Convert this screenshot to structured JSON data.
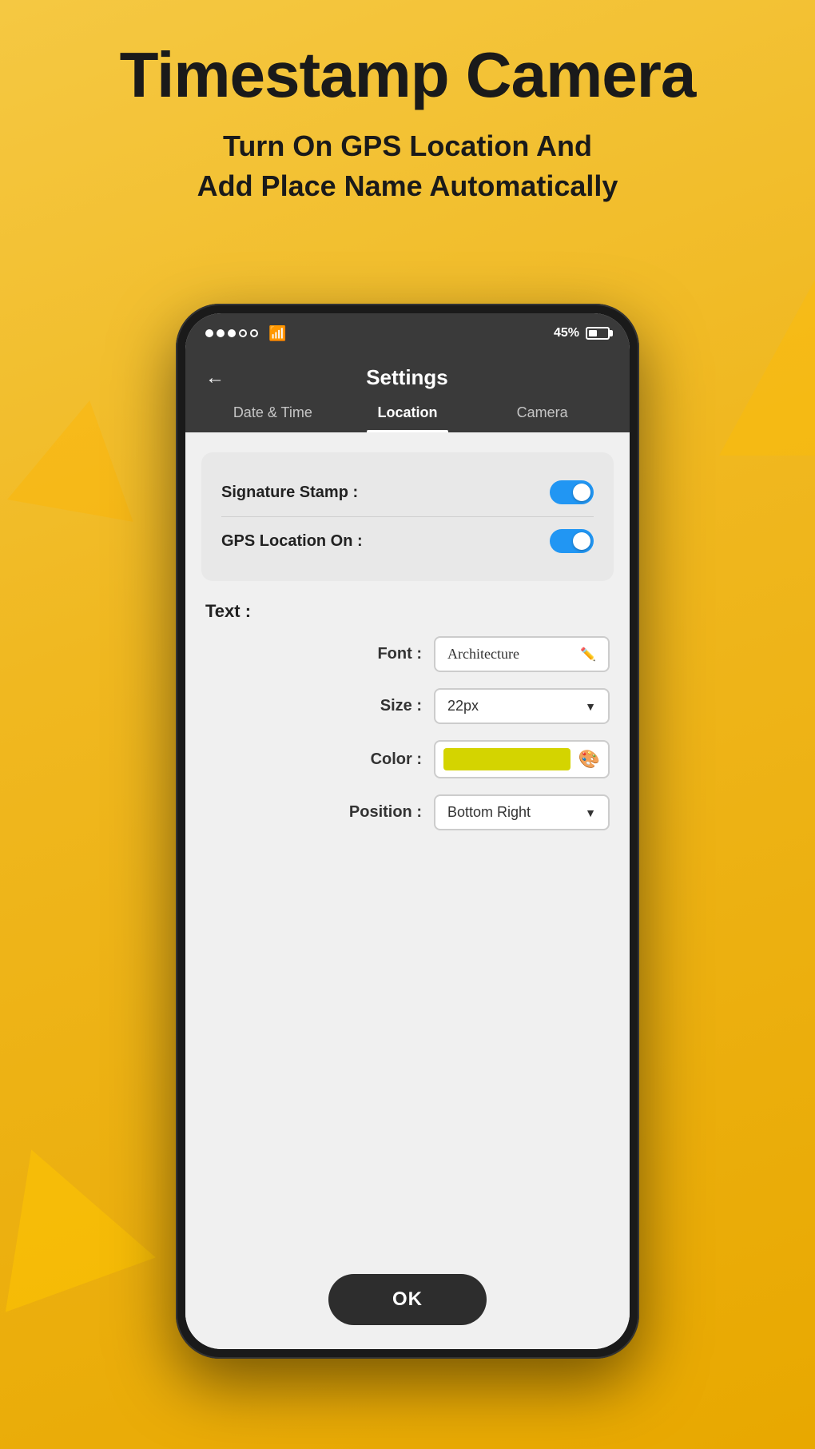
{
  "header": {
    "title": "Timestamp Camera",
    "subtitle_line1": "Turn On GPS Location And",
    "subtitle_line2": "Add Place Name Automatically"
  },
  "status_bar": {
    "battery_percent": "45%",
    "wifi_label": "wifi"
  },
  "app_header": {
    "page_title": "Settings",
    "back_label": "←"
  },
  "tabs": [
    {
      "label": "Date & Time",
      "active": false
    },
    {
      "label": "Location",
      "active": true
    },
    {
      "label": "Camera",
      "active": false
    }
  ],
  "toggles": {
    "signature_stamp_label": "Signature Stamp :",
    "gps_location_label": "GPS Location On :",
    "signature_stamp_on": true,
    "gps_location_on": true
  },
  "text_section": {
    "title": "Text :",
    "font_label": "Font :",
    "font_value": "Architecture",
    "size_label": "Size :",
    "size_value": "22px",
    "color_label": "Color :",
    "color_hex": "#d4d400",
    "position_label": "Position :",
    "position_value": "Bottom Right"
  },
  "ok_button": "OK"
}
